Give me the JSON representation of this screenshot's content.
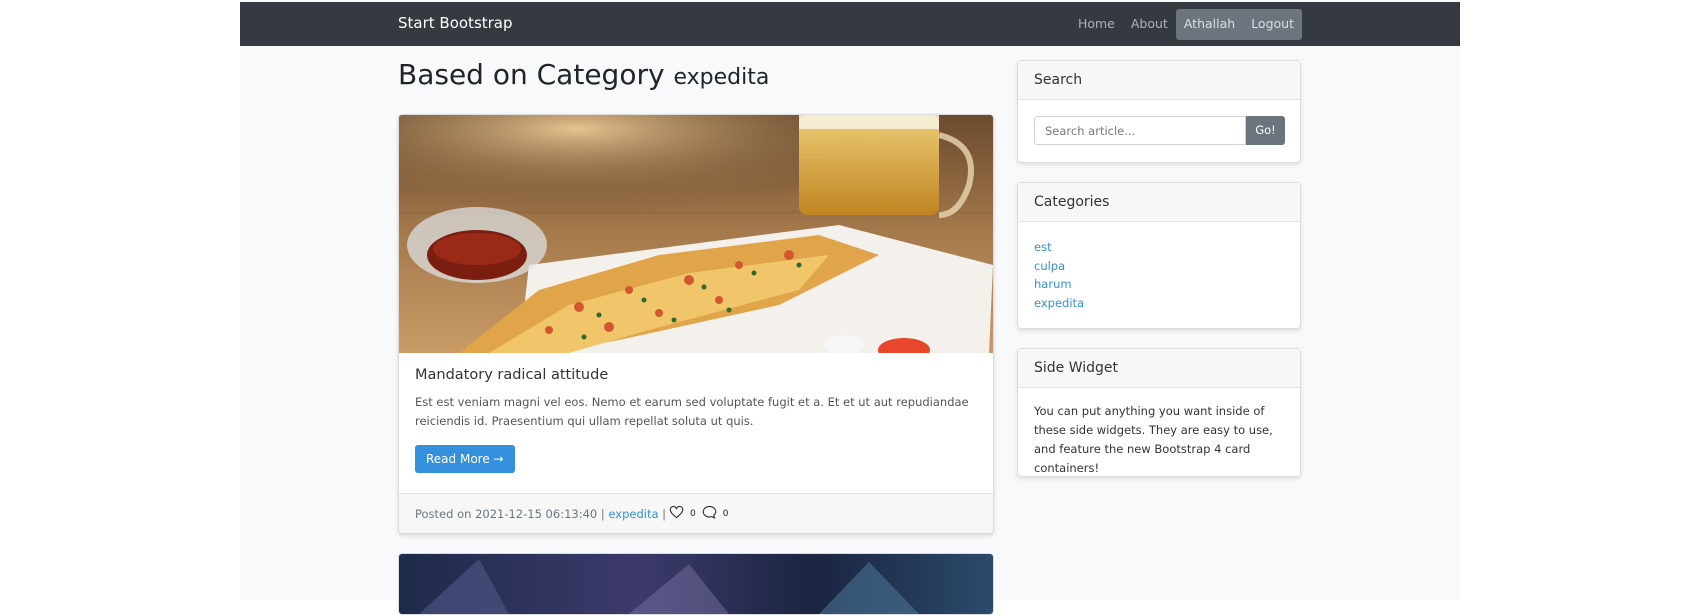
{
  "navbar": {
    "brand": "Start Bootstrap",
    "links": [
      "Home",
      "About"
    ],
    "user": "Athallah",
    "logout": "Logout"
  },
  "heading": {
    "title": "Based on Category",
    "category": "expedita"
  },
  "post": {
    "title": "Mandatory radical attitude",
    "excerpt": "Est est veniam magni vel eos. Nemo et earum sed voluptate fugit et a. Et et ut aut repudiandae reiciendis id. Praesentium qui ullam repellat soluta ut quis.",
    "read_more": "Read More →",
    "posted_on": "Posted on 2021-12-15 06:13:40 |",
    "category": "expedita",
    "separator": "|",
    "likes": "0",
    "comments": "0"
  },
  "sidebar": {
    "search": {
      "title": "Search",
      "placeholder": "Search article...",
      "button": "Go!"
    },
    "categories": {
      "title": "Categories",
      "items": [
        "est",
        "culpa",
        "harum",
        "expedita"
      ]
    },
    "widget": {
      "title": "Side Widget",
      "text": "You can put anything you want inside of these side widgets. They are easy to use, and feature the new Bootstrap 4 card containers!"
    }
  },
  "colors": {
    "navbar": "#343a40",
    "link": "#3490dc",
    "primary_button": "#3490dc",
    "secondary_button": "#6c757d"
  },
  "icons": {
    "like": "heart-icon",
    "comment": "comment-icon"
  }
}
